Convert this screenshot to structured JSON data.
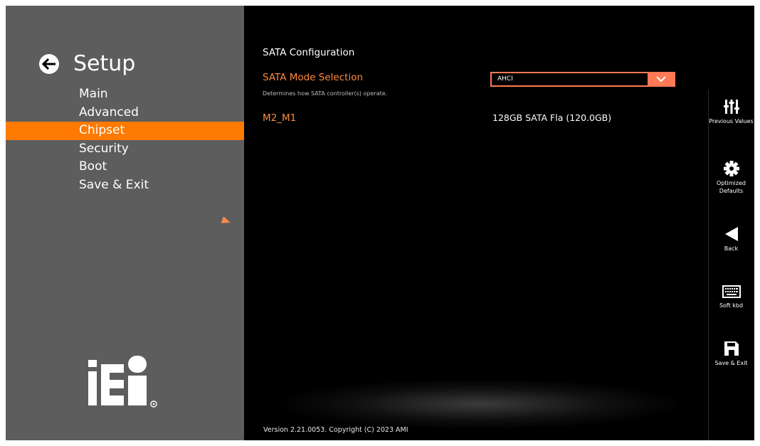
{
  "setup": {
    "title": "Setup",
    "menu": [
      {
        "label": "Main",
        "selected": false
      },
      {
        "label": "Advanced",
        "selected": false
      },
      {
        "label": "Chipset",
        "selected": true
      },
      {
        "label": "Security",
        "selected": false
      },
      {
        "label": "Boot",
        "selected": false
      },
      {
        "label": "Save & Exit",
        "selected": false
      }
    ]
  },
  "content": {
    "section_title": "SATA Configuration",
    "sata_mode": {
      "label": "SATA Mode Selection",
      "help": "Determines how SATA controller(s) operate.",
      "value": "AHCI"
    },
    "m2": {
      "label": "M2_M1",
      "value": "128GB SATA Fla (120.0GB)"
    },
    "version": "Version 2.21.0053. Copyright (C) 2023 AMI"
  },
  "toolbar": {
    "previous_values": "Previous Values",
    "optimized_defaults": "Optimized Defaults",
    "back": "Back",
    "soft_kbd": "Soft kbd",
    "save_exit": "Save & Exit"
  },
  "logo": "iEi",
  "colors": {
    "accent": "#ff7a00",
    "label_orange": "#ff8a3d",
    "left_panel": "#5d5d5d",
    "main_bg": "#000000"
  }
}
